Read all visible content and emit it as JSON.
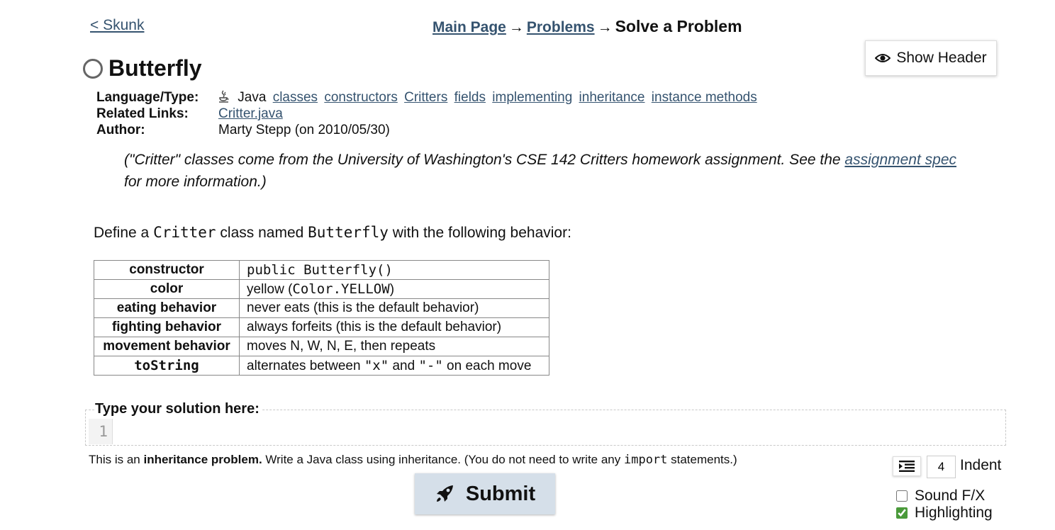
{
  "nav": {
    "back_label": "< Skunk",
    "crumbs": {
      "main_page": "Main Page",
      "arrow": "→",
      "problems": "Problems",
      "current": "Solve a Problem"
    },
    "show_header_label": "Show Header"
  },
  "problem": {
    "title": "Butterfly",
    "meta": {
      "language_label": "Language/Type:",
      "language_value": "Java",
      "tags": [
        "classes",
        "constructors",
        "Critters",
        "fields",
        "implementing",
        "inheritance",
        "instance methods"
      ],
      "related_label": "Related Links:",
      "related_link": "Critter.java",
      "author_label": "Author:",
      "author_value": "Marty Stepp (on 2010/05/30)"
    },
    "note": {
      "before": "(\"Critter\" classes come from the University of Washington's CSE 142 Critters homework assignment. See the ",
      "link": "assignment spec",
      "after": " for more information.)"
    },
    "define": {
      "t1": "Define a ",
      "code1": "Critter",
      "t2": " class named ",
      "code2": "Butterfly",
      "t3": " with the following behavior:"
    },
    "behavior_table": [
      {
        "key": "constructor",
        "value": "public Butterfly()"
      },
      {
        "key": "color",
        "value_pre": "yellow (",
        "value_code": "Color.YELLOW",
        "value_post": ")"
      },
      {
        "key": "eating behavior",
        "value": "never eats (this is the default behavior)"
      },
      {
        "key": "fighting behavior",
        "value": "always forfeits (this is the default behavior)"
      },
      {
        "key": "movement behavior",
        "value": "moves N, W, N, E, then repeats"
      },
      {
        "key": "toString",
        "value_pre": "alternates between ",
        "code_a": "\"x\"",
        "value_mid": " and ",
        "code_b": "\"-\"",
        "value_post": " on each move"
      }
    ]
  },
  "editor": {
    "legend": "Type your solution here:",
    "line_number": "1"
  },
  "hint": {
    "t1": "This is an ",
    "bold": "inheritance problem.",
    "t2": " Write a Java class using inheritance. (You do not need to write any ",
    "code": "import",
    "t3": " statements.)"
  },
  "controls": {
    "submit_label": "Submit",
    "indent_value": "4",
    "indent_label": "Indent",
    "sound_label": "Sound F/X",
    "sound_checked": false,
    "highlight_label": "Highlighting",
    "highlight_checked": true
  },
  "icons": {
    "eye": "eye-icon",
    "java": "java-cup-icon",
    "rocket": "rocket-icon",
    "indent": "indent-icon"
  }
}
